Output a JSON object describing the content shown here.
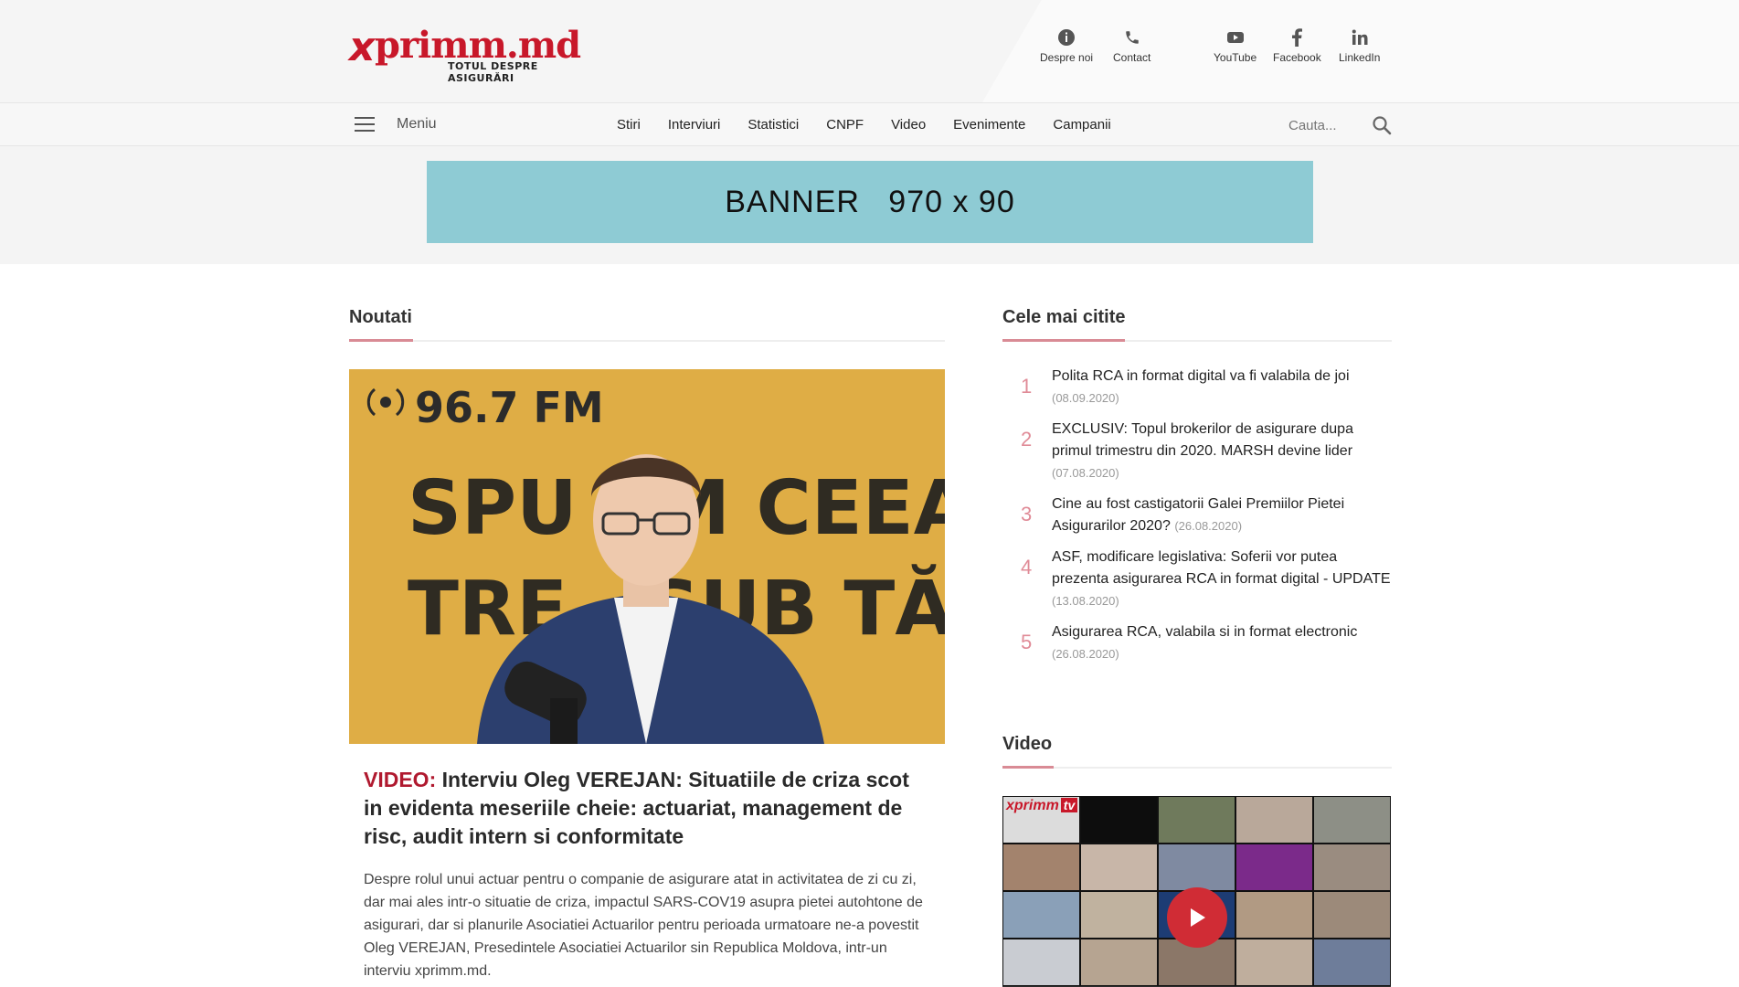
{
  "header": {
    "logo_mark": "x",
    "logo_name": "primm.md",
    "logo_tagline": "TOTUL DESPRE ASIGURĂRI",
    "links": [
      {
        "label": "Despre noi",
        "icon": "info-icon"
      },
      {
        "label": "Contact",
        "icon": "phone-icon"
      },
      {
        "label": "YouTube",
        "icon": "youtube-icon"
      },
      {
        "label": "Facebook",
        "icon": "facebook-icon"
      },
      {
        "label": "LinkedIn",
        "icon": "linkedin-icon"
      }
    ]
  },
  "nav": {
    "menu_label": "Meniu",
    "items": [
      "Stiri",
      "Interviuri",
      "Statistici",
      "CNPF",
      "Video",
      "Evenimente",
      "Campanii"
    ],
    "search_placeholder": "Cauta..."
  },
  "banner": {
    "text": "BANNER   970 x 90"
  },
  "news": {
    "section_title": "Noutati",
    "hero": {
      "tag": "VIDEO:",
      "title": " Interviu Oleg VEREJAN: Situatiile de criza scot in evidenta meseriile cheie: actuariat, management de risc, audit intern si conformitate",
      "excerpt": "Despre rolul unui actuar pentru o companie de asigurare atat in activitatea de zi cu zi, dar mai ales intr-o situatie de criza, impactul SARS-COV19 asupra pietei autohtone de asigurari, dar si planurile Asociatiei Actuarilor pentru perioada urmatoare ne-a povestit Oleg VEREJAN, Presedintele Asociatiei Actuarilor sin Republica Moldova, intr-un interviu xprimm.md.",
      "image_text_1": "96.7 FM",
      "image_text_2": "SPU   M CEEA",
      "image_text_3": "TRE   SUB TĂC"
    }
  },
  "popular": {
    "section_title": "Cele mai citite",
    "items": [
      {
        "num": "1",
        "title": "Polita RCA in format digital va fi valabila de joi",
        "date": "(08.09.2020)"
      },
      {
        "num": "2",
        "title": "EXCLUSIV: Topul brokerilor de asigurare dupa primul trimestru din 2020. MARSH devine lider",
        "date": "(07.08.2020)"
      },
      {
        "num": "3",
        "title": "Cine au fost castigatorii Galei Premiilor Pietei Asigurarilor 2020?",
        "date": "(26.08.2020)"
      },
      {
        "num": "4",
        "title": "ASF, modificare legislativa: Soferii vor putea prezenta asigurarea RCA in format digital - UPDATE",
        "date": "(13.08.2020)"
      },
      {
        "num": "5",
        "title": "Asigurarea RCA, valabila si in format electronic",
        "date": "(26.08.2020)"
      }
    ]
  },
  "video": {
    "section_title": "Video",
    "logo_a": "xprimm",
    "logo_b": "tv"
  },
  "colors": {
    "brand": "#c8182a",
    "accent_line": "#d98b95",
    "banner": "#8ecbd4"
  }
}
